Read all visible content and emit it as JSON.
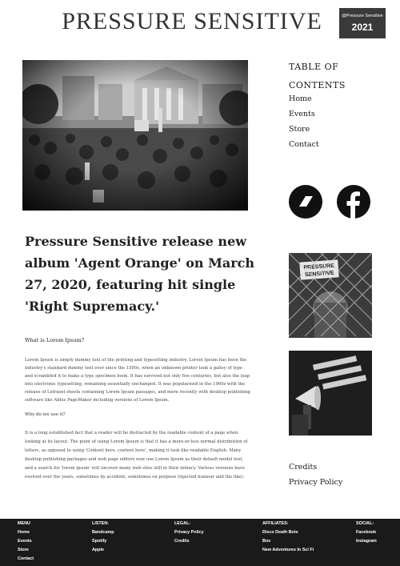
{
  "header": {
    "title": "PRESSURE SENSITIVE",
    "handle": "@Pressure Sensitive",
    "year": "2021"
  },
  "toc": {
    "title": "TABLE OF CONTENTS",
    "items": [
      "Home",
      "Events",
      "Store",
      "Contact"
    ]
  },
  "social": [
    "bandcamp-icon",
    "facebook-icon"
  ],
  "article": {
    "headline": "Pressure Sensitive release new album 'Agent Orange' on  March 27, 2020, featuring hit single 'Right Supremacy.'",
    "q1": "What is Lorem Ipsum?",
    "para1": "Lorem Ipsum is simply dummy text of the printing and typesetting industry. Lorem Ipsum has been the industry's standard dummy text ever since the 1500s, when an unknown printer took a galley of type and scrambled it to make a type specimen book. It has survived not only five centuries, but also the leap into electronic typesetting, remaining essentially unchanged. It was popularised in the 1960s with the release of Letraset sheets containing Lorem Ipsum passages, and more recently with desktop publishing software like Aldus PageMaker including versions of Lorem Ipsum.",
    "q2": "Why do we use it?",
    "para2": "It is a long established fact that a reader will be distracted by the readable content of a page when looking at its layout. The point of using Lorem Ipsum is that it has a more-or-less normal distribution of letters, as opposed to using 'Content here, content here', making it look like readable English. Many desktop publishing packages and web page editors now use Lorem Ipsum as their default model text, and a search for 'lorem ipsum' will uncover many web sites still in their infancy. Various versions have evolved over the years, sometimes by accident, sometimes on purpose (injected humour and the like)."
  },
  "thumb1": {
    "sign_line1": "PRESSURE",
    "sign_line2": "SENSITIVE"
  },
  "side_links": [
    "Credits",
    "Privacy Policy"
  ],
  "footer": {
    "menu": {
      "heading": "MENU",
      "items": [
        "Home",
        "Events",
        "Store",
        "Contact"
      ]
    },
    "listen": {
      "heading": "LISTEN:",
      "items": [
        "Bandcamp",
        "Spotify",
        "Apple"
      ]
    },
    "legal": {
      "heading": "LEGAL:",
      "items": [
        "Privacy Policy",
        "Credits"
      ]
    },
    "affiliates": {
      "heading": "AFFILIATES:",
      "items": [
        "Disco Death Bots",
        "Box",
        "New Adventures In Sci Fi"
      ]
    },
    "social": {
      "heading": "SOCIAL:",
      "items": [
        "Facebook",
        "Instagram"
      ]
    }
  },
  "colors": {
    "footer_bg": "#1a1a1a",
    "handle_bg": "#3a3a3a",
    "text": "#1a1a1a"
  }
}
